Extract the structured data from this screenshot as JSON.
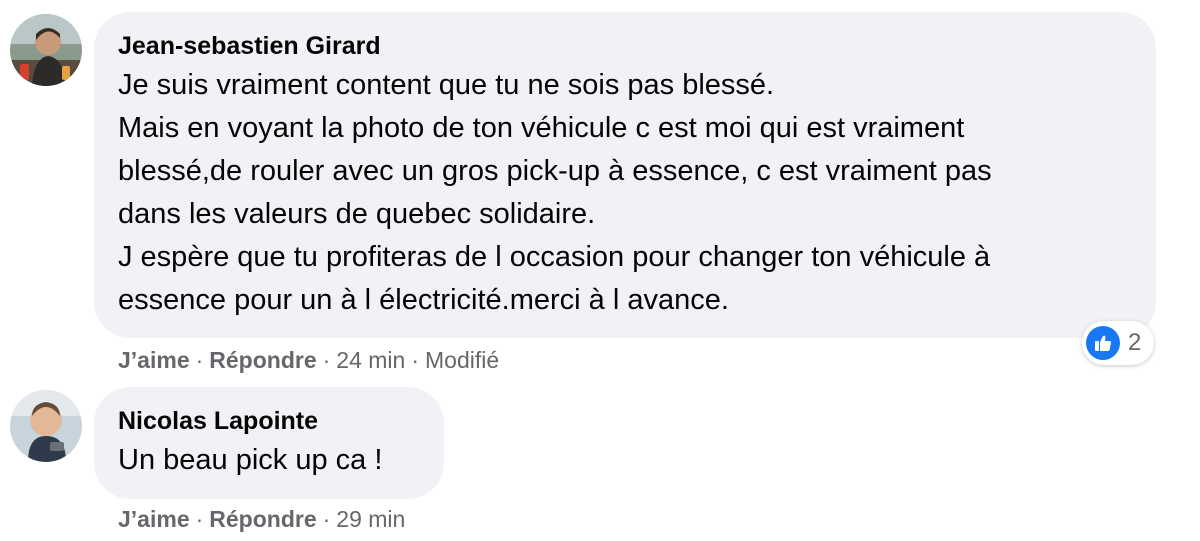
{
  "comments": [
    {
      "author": "Jean-sebastien Girard",
      "lines": [
        "Je suis vraiment content que tu ne sois pas blessé.",
        "Mais en voyant la photo de ton véhicule c est moi qui est vraiment",
        "blessé,de rouler avec un gros pick-up à essence, c est vraiment pas",
        "dans les valeurs de quebec solidaire.",
        "J espère que tu profiteras de l occasion pour changer ton véhicule à",
        "essence pour un à l électricité.merci à l avance."
      ],
      "like_label": "J’aime",
      "reply_label": "Répondre",
      "time": "24 min",
      "edited": "Modifié",
      "reaction_icon": "like-thumb-icon",
      "reaction_count": "2"
    },
    {
      "author": "Nicolas Lapointe",
      "lines": [
        "Un beau pick up ca !"
      ],
      "like_label": "J’aime",
      "reply_label": "Répondre",
      "time": "29 min"
    }
  ],
  "separator": "·",
  "colors": {
    "bubble": "#f0f2f5",
    "text": "#050505",
    "meta": "#65676b",
    "like_blue": "#1877f2"
  }
}
